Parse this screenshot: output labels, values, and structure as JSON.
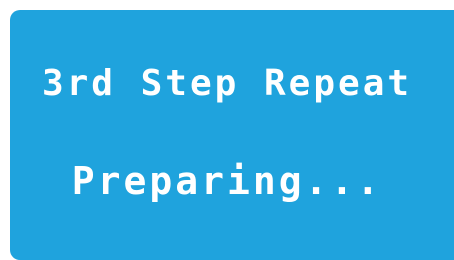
{
  "dialog": {
    "title": "3rd Step Repeat",
    "status": "Preparing...",
    "background_color": "#1fa3dd",
    "text_color": "#ffffff"
  }
}
